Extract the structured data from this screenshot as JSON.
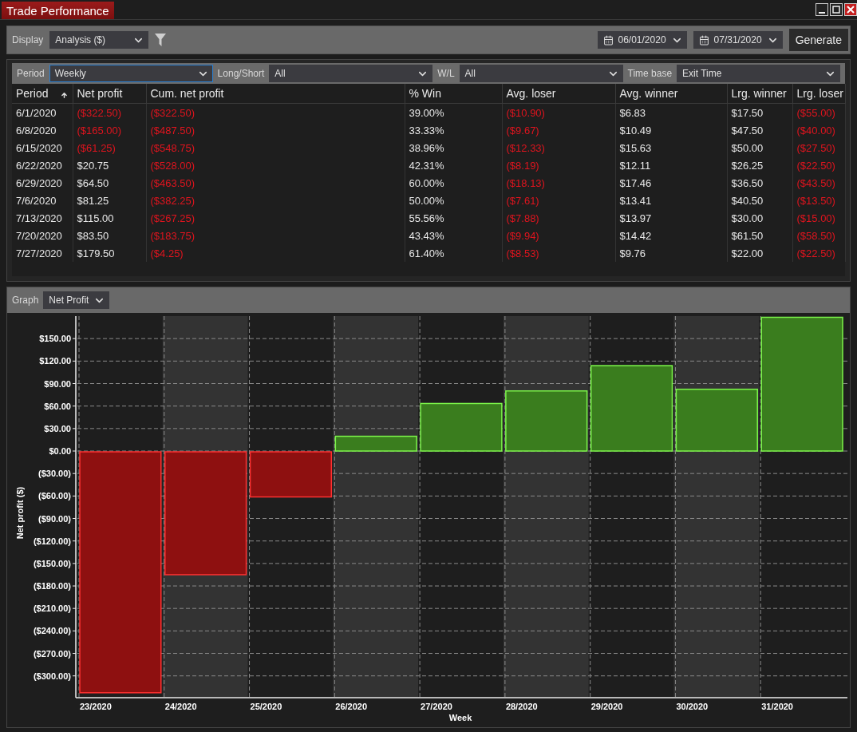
{
  "window": {
    "title": "Trade Performance"
  },
  "toolbar": {
    "display_label": "Display",
    "display_value": "Analysis ($)",
    "start_date": "06/01/2020",
    "end_date": "07/31/2020",
    "generate_button": "Generate"
  },
  "filters": [
    {
      "label": "Period",
      "value": "Weekly",
      "focused": true
    },
    {
      "label": "Long/Short",
      "value": "All",
      "focused": false
    },
    {
      "label": "W/L",
      "value": "All",
      "focused": false
    },
    {
      "label": "Time base",
      "value": "Exit Time",
      "focused": false
    }
  ],
  "table": {
    "columns": [
      {
        "label": "Period",
        "sorted": true
      },
      {
        "label": "Net profit",
        "sorted": false
      },
      {
        "label": "Cum. net profit",
        "sorted": false
      },
      {
        "label": "% Win",
        "sorted": false
      },
      {
        "label": "Avg. loser",
        "sorted": false
      },
      {
        "label": "Avg. winner",
        "sorted": false
      },
      {
        "label": "Lrg. winner",
        "sorted": false
      },
      {
        "label": "Lrg. loser",
        "sorted": false
      }
    ],
    "rows": [
      [
        {
          "text": "6/1/2020",
          "negative": false
        },
        {
          "text": "($322.50)",
          "negative": true
        },
        {
          "text": "($322.50)",
          "negative": true
        },
        {
          "text": "39.00%",
          "negative": false
        },
        {
          "text": "($10.90)",
          "negative": true
        },
        {
          "text": "$6.83",
          "negative": false
        },
        {
          "text": "$17.50",
          "negative": false
        },
        {
          "text": "($55.00)",
          "negative": true
        }
      ],
      [
        {
          "text": "6/8/2020",
          "negative": false
        },
        {
          "text": "($165.00)",
          "negative": true
        },
        {
          "text": "($487.50)",
          "negative": true
        },
        {
          "text": "33.33%",
          "negative": false
        },
        {
          "text": "($9.67)",
          "negative": true
        },
        {
          "text": "$10.49",
          "negative": false
        },
        {
          "text": "$47.50",
          "negative": false
        },
        {
          "text": "($40.00)",
          "negative": true
        }
      ],
      [
        {
          "text": "6/15/2020",
          "negative": false
        },
        {
          "text": "($61.25)",
          "negative": true
        },
        {
          "text": "($548.75)",
          "negative": true
        },
        {
          "text": "38.96%",
          "negative": false
        },
        {
          "text": "($12.33)",
          "negative": true
        },
        {
          "text": "$15.63",
          "negative": false
        },
        {
          "text": "$50.00",
          "negative": false
        },
        {
          "text": "($27.50)",
          "negative": true
        }
      ],
      [
        {
          "text": "6/22/2020",
          "negative": false
        },
        {
          "text": "$20.75",
          "negative": false
        },
        {
          "text": "($528.00)",
          "negative": true
        },
        {
          "text": "42.31%",
          "negative": false
        },
        {
          "text": "($8.19)",
          "negative": true
        },
        {
          "text": "$12.11",
          "negative": false
        },
        {
          "text": "$26.25",
          "negative": false
        },
        {
          "text": "($22.50)",
          "negative": true
        }
      ],
      [
        {
          "text": "6/29/2020",
          "negative": false
        },
        {
          "text": "$64.50",
          "negative": false
        },
        {
          "text": "($463.50)",
          "negative": true
        },
        {
          "text": "60.00%",
          "negative": false
        },
        {
          "text": "($18.13)",
          "negative": true
        },
        {
          "text": "$17.46",
          "negative": false
        },
        {
          "text": "$36.50",
          "negative": false
        },
        {
          "text": "($43.50)",
          "negative": true
        }
      ],
      [
        {
          "text": "7/6/2020",
          "negative": false
        },
        {
          "text": "$81.25",
          "negative": false
        },
        {
          "text": "($382.25)",
          "negative": true
        },
        {
          "text": "50.00%",
          "negative": false
        },
        {
          "text": "($7.61)",
          "negative": true
        },
        {
          "text": "$13.41",
          "negative": false
        },
        {
          "text": "$40.50",
          "negative": false
        },
        {
          "text": "($13.50)",
          "negative": true
        }
      ],
      [
        {
          "text": "7/13/2020",
          "negative": false
        },
        {
          "text": "$115.00",
          "negative": false
        },
        {
          "text": "($267.25)",
          "negative": true
        },
        {
          "text": "55.56%",
          "negative": false
        },
        {
          "text": "($7.88)",
          "negative": true
        },
        {
          "text": "$13.97",
          "negative": false
        },
        {
          "text": "$30.00",
          "negative": false
        },
        {
          "text": "($15.00)",
          "negative": true
        }
      ],
      [
        {
          "text": "7/20/2020",
          "negative": false
        },
        {
          "text": "$83.50",
          "negative": false
        },
        {
          "text": "($183.75)",
          "negative": true
        },
        {
          "text": "43.43%",
          "negative": false
        },
        {
          "text": "($9.94)",
          "negative": true
        },
        {
          "text": "$14.42",
          "negative": false
        },
        {
          "text": "$61.50",
          "negative": false
        },
        {
          "text": "($58.50)",
          "negative": true
        }
      ],
      [
        {
          "text": "7/27/2020",
          "negative": false
        },
        {
          "text": "$179.50",
          "negative": false
        },
        {
          "text": "($4.25)",
          "negative": true
        },
        {
          "text": "61.40%",
          "negative": false
        },
        {
          "text": "($8.53)",
          "negative": true
        },
        {
          "text": "$9.76",
          "negative": false
        },
        {
          "text": "$22.00",
          "negative": false
        },
        {
          "text": "($22.50)",
          "negative": true
        }
      ]
    ]
  },
  "graph": {
    "label": "Graph",
    "selector": "Net Profit",
    "chart_data": {
      "type": "bar",
      "xlabel": "Week",
      "ylabel": "Net profit ($)",
      "categories": [
        "23/2020",
        "24/2020",
        "25/2020",
        "26/2020",
        "27/2020",
        "28/2020",
        "29/2020",
        "30/2020",
        "31/2020"
      ],
      "grid": true,
      "series": [
        {
          "color": "#8e1010",
          "values": [
            -322.5,
            -165,
            -61.25,
            null,
            null,
            null,
            null,
            null,
            null
          ]
        },
        {
          "color": "#3a7d1e",
          "values": [
            null,
            null,
            null,
            20.75,
            64.5,
            81.25,
            115,
            83.5,
            179.5
          ]
        }
      ],
      "ylim": [
        -328,
        180
      ],
      "yticks": [
        {
          "value": 150,
          "label": "$150.00"
        },
        {
          "value": 120,
          "label": "$120.00"
        },
        {
          "value": 90,
          "label": "$90.00"
        },
        {
          "value": 60,
          "label": "$60.00"
        },
        {
          "value": 30,
          "label": "$30.00"
        },
        {
          "value": 0,
          "label": "$0.00"
        },
        {
          "value": -30,
          "label": "($30.00)"
        },
        {
          "value": -60,
          "label": "($60.00)"
        },
        {
          "value": -90,
          "label": "($90.00)"
        },
        {
          "value": -120,
          "label": "($120.00)"
        },
        {
          "value": -150,
          "label": "($150.00)"
        },
        {
          "value": -180,
          "label": "($180.00)"
        },
        {
          "value": -210,
          "label": "($210.00)"
        },
        {
          "value": -240,
          "label": "($240.00)"
        },
        {
          "value": -270,
          "label": "($270.00)"
        },
        {
          "value": -300,
          "label": "($300.00)"
        }
      ]
    }
  }
}
